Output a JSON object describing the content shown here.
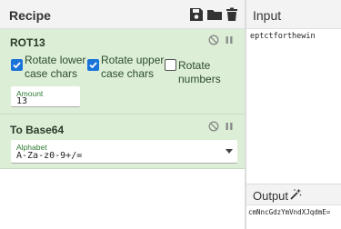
{
  "recipe": {
    "title": "Recipe"
  },
  "operations": [
    {
      "name": "ROT13",
      "options": {
        "rotate_lower": {
          "label_line1": "Rotate lower",
          "label_line2": "case chars",
          "checked": true
        },
        "rotate_upper": {
          "label_line1": "Rotate upper",
          "label_line2": "case chars",
          "checked": true
        },
        "rotate_numbers": {
          "label": "Rotate numbers",
          "checked": false
        },
        "amount": {
          "label": "Amount",
          "value": "13"
        }
      }
    },
    {
      "name": "To Base64",
      "options": {
        "alphabet": {
          "label": "Alphabet",
          "value": "A-Za-z0-9+/="
        }
      }
    }
  ],
  "input": {
    "title": "Input",
    "value": "eptctforthewin"
  },
  "output": {
    "title": "Output",
    "value": "cmNncGdzYmVndXJqdmE="
  },
  "colors": {
    "operation_bg": "#dcefd6",
    "checkbox_accent": "#1a73d9",
    "field_label": "#2e7d32"
  },
  "icons": [
    "save-icon",
    "folder-icon",
    "trash-icon",
    "disable-icon",
    "pause-icon",
    "magic-wand-icon",
    "chevron-down-icon",
    "checkmark-icon"
  ]
}
